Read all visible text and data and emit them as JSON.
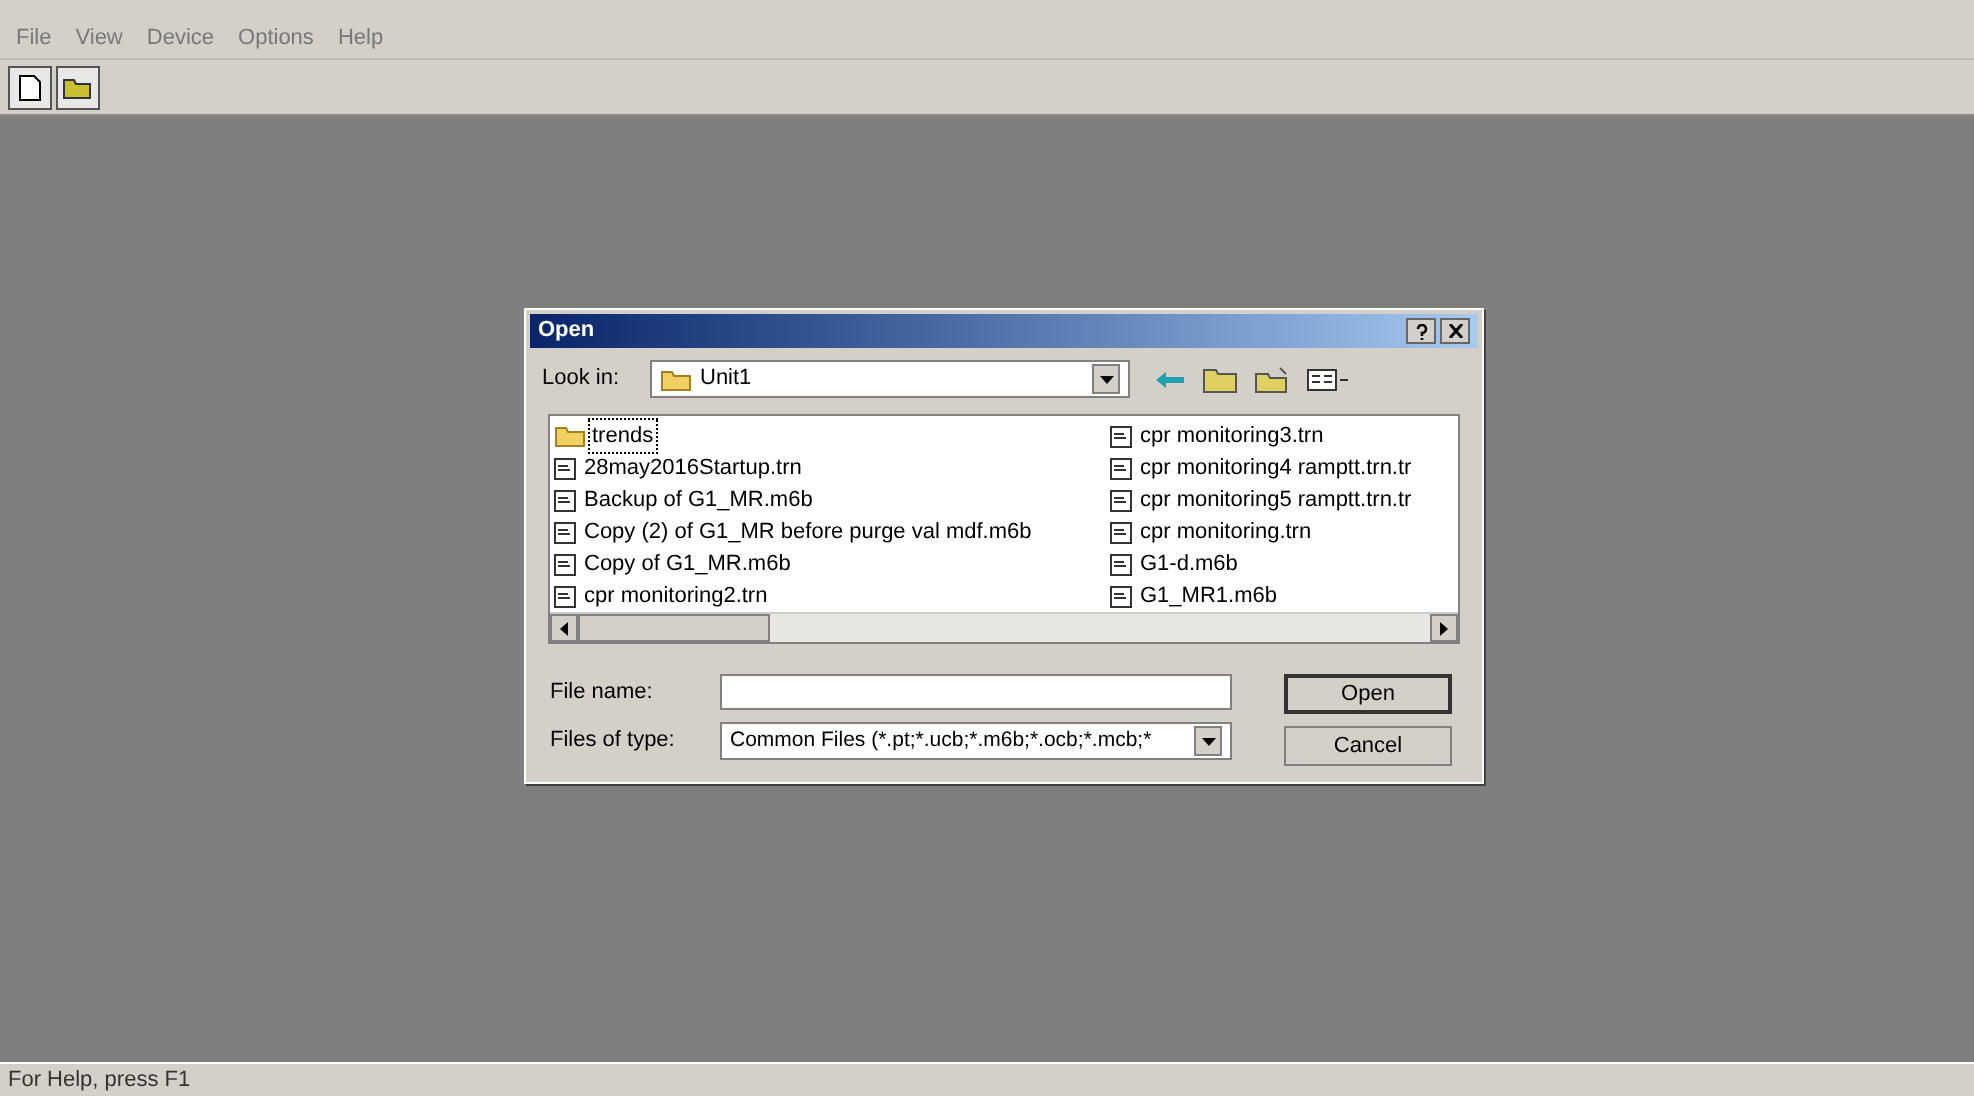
{
  "menu": [
    "File",
    "View",
    "Device",
    "Options",
    "Help"
  ],
  "dialog": {
    "title": "Open",
    "look_in": {
      "label": "Look in:",
      "value": "Unit1"
    },
    "files": [
      {
        "name": "trends",
        "kind": "folder",
        "focused": true
      },
      {
        "name": "28may2016Startup.trn",
        "kind": "file",
        "focused": false
      },
      {
        "name": "Backup of G1_MR.m6b",
        "kind": "file",
        "focused": false
      },
      {
        "name": "Copy (2) of G1_MR before purge val mdf.m6b",
        "kind": "file",
        "focused": false
      },
      {
        "name": "Copy of G1_MR.m6b",
        "kind": "file",
        "focused": false
      },
      {
        "name": "cpr monitoring2.trn",
        "kind": "file",
        "focused": false
      },
      {
        "name": "cpr monitoring3.trn",
        "kind": "file",
        "focused": false
      },
      {
        "name": "cpr monitoring4 ramptt.trn.tr",
        "kind": "file",
        "focused": false
      },
      {
        "name": "cpr monitoring5 ramptt.trn.tr",
        "kind": "file",
        "focused": false
      },
      {
        "name": "cpr monitoring.trn",
        "kind": "file",
        "focused": false
      },
      {
        "name": "G1-d.m6b",
        "kind": "file",
        "focused": false
      },
      {
        "name": "G1_MR1.m6b",
        "kind": "file",
        "focused": false
      }
    ],
    "file_name": {
      "label": "File name:"
    },
    "file_type": {
      "label": "Files of type:",
      "value": "Common Files (*.pt;*.ucb;*.m6b;*.ocb;*.mcb;*"
    },
    "buttons": [
      "Open",
      "Cancel"
    ]
  },
  "status_bar": "For Help, press F1"
}
